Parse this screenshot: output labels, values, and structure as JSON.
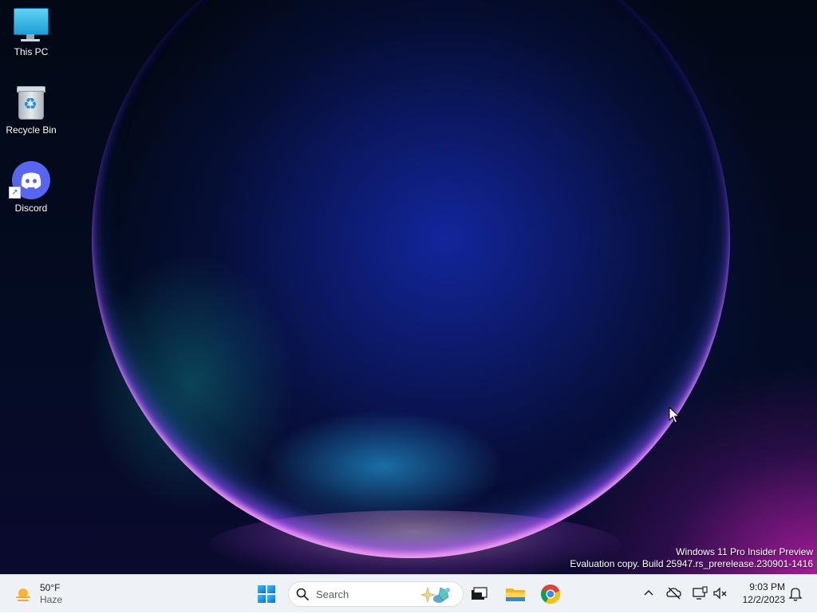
{
  "desktop": {
    "icons": [
      {
        "label": "This PC",
        "icon": "this-pc-icon"
      },
      {
        "label": "Recycle Bin",
        "icon": "recycle-bin-icon"
      },
      {
        "label": "Discord",
        "icon": "discord-icon"
      }
    ],
    "watermark": {
      "line1": "Windows 11 Pro Insider Preview",
      "line2": "Evaluation copy. Build 25947.rs_prerelease.230901-1416"
    }
  },
  "taskbar": {
    "weather": {
      "temp": "50°F",
      "condition": "Haze",
      "icon": "haze-sun-icon"
    },
    "start": {
      "icon": "windows-start-icon"
    },
    "search": {
      "placeholder": "Search",
      "icon": "search-icon"
    },
    "apps": [
      {
        "name": "Task View",
        "icon": "task-view-icon"
      },
      {
        "name": "File Explorer",
        "icon": "folder-icon"
      },
      {
        "name": "Google Chrome",
        "icon": "chrome-icon"
      }
    ],
    "tray": {
      "icons": [
        "chevron-up-icon",
        "cloud-offline-icon",
        "network-icon",
        "speaker-muted-icon"
      ],
      "time": "9:03 PM",
      "date": "12/2/2023",
      "notification_icon": "bell-icon"
    }
  },
  "colors": {
    "taskbar_bg": "#eef1f5",
    "accent_blue": "#0a6fd6",
    "discord": "#5865f2"
  }
}
